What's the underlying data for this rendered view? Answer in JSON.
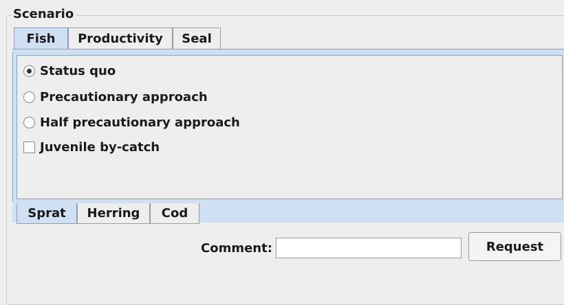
{
  "group": {
    "title": "Scenario"
  },
  "tabs": [
    {
      "label": "Fish",
      "selected": true
    },
    {
      "label": "Productivity",
      "selected": false
    },
    {
      "label": "Seal",
      "selected": false
    }
  ],
  "options": [
    {
      "type": "radio",
      "label": "Status quo",
      "checked": true
    },
    {
      "type": "radio",
      "label": "Precautionary approach",
      "checked": false
    },
    {
      "type": "radio",
      "label": "Half precautionary approach",
      "checked": false
    },
    {
      "type": "checkbox",
      "label": "Juvenile by-catch",
      "checked": false
    }
  ],
  "species_tabs": [
    {
      "label": "Sprat",
      "selected": true
    },
    {
      "label": "Herring",
      "selected": false
    },
    {
      "label": "Cod",
      "selected": false
    }
  ],
  "comment": {
    "label": "Comment:",
    "value": "",
    "placeholder": ""
  },
  "request_button": {
    "label": "Request"
  },
  "colors": {
    "selected_tab": "#cfe0f3",
    "panel_border": "#8a9fb8",
    "background": "#eeeeee"
  }
}
